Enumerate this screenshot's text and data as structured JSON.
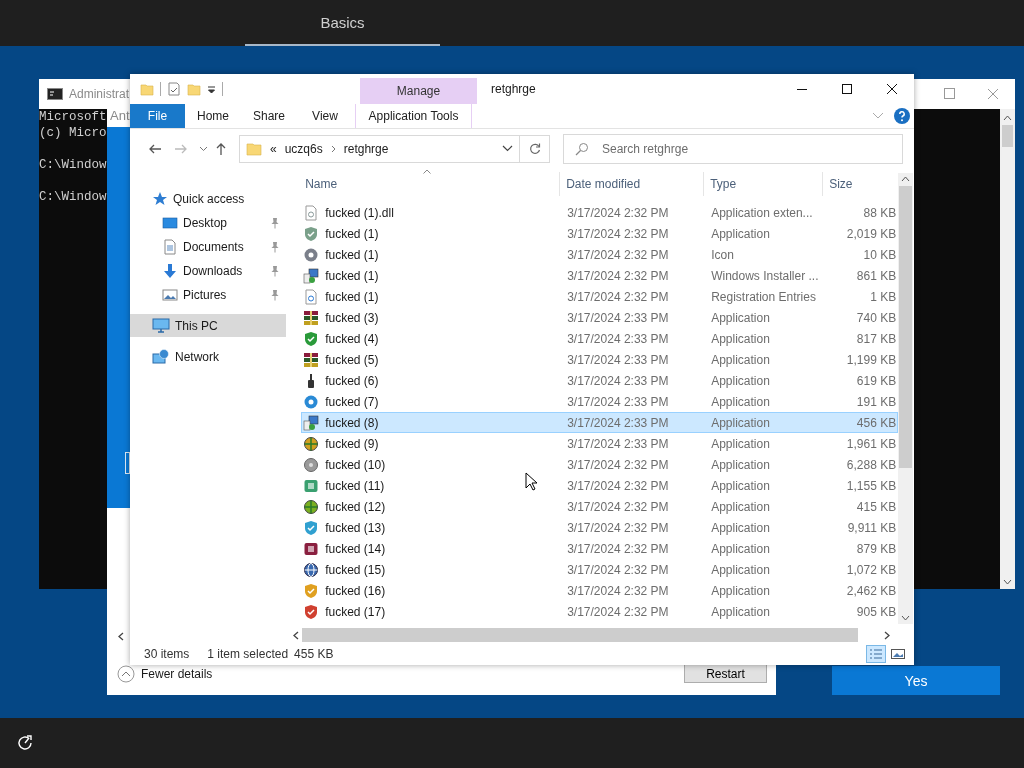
{
  "setup_header": {
    "tabs": [
      {
        "label": "Basics",
        "selected": true
      }
    ]
  },
  "console_window": {
    "title": "Administrat",
    "blocks": [
      [
        "Microsoft",
        "(c) Micro"
      ],
      [
        "C:\\Window"
      ],
      [
        "C:\\Window"
      ]
    ]
  },
  "dialog": {
    "title": "Ant",
    "details_toggle": "Fewer details",
    "buttons": [
      "Restart"
    ]
  },
  "yes_button": "Yes",
  "explorer": {
    "title": "retghrge",
    "context_group": "Manage",
    "ribbon_tabs": [
      {
        "label": "File",
        "kind": "file"
      },
      {
        "label": "Home",
        "kind": "normal"
      },
      {
        "label": "Share",
        "kind": "normal"
      },
      {
        "label": "View",
        "kind": "normal"
      },
      {
        "label": "Application Tools",
        "kind": "contextual"
      }
    ],
    "address": {
      "overflow": "«",
      "breadcrumbs": [
        "uczq6s",
        "retghrge"
      ]
    },
    "search": {
      "placeholder": "Search retghrge"
    },
    "nav_pane": [
      {
        "label": "Quick access",
        "kind": "quick",
        "selected": false,
        "children": [
          {
            "label": "Desktop",
            "kind": "desktop",
            "selected": false,
            "pinned": true
          },
          {
            "label": "Documents",
            "kind": "documents",
            "selected": false,
            "pinned": true
          },
          {
            "label": "Downloads",
            "kind": "downloads",
            "selected": false,
            "pinned": true
          },
          {
            "label": "Pictures",
            "kind": "pictures",
            "selected": false,
            "pinned": true
          }
        ]
      },
      {
        "label": "This PC",
        "kind": "pc",
        "selected": true
      },
      {
        "label": "Network",
        "kind": "network",
        "selected": false
      }
    ],
    "columns": [
      {
        "label": "Name",
        "sorted": true
      },
      {
        "label": "Date modified",
        "sorted": false
      },
      {
        "label": "Type",
        "sorted": false
      },
      {
        "label": "Size",
        "sorted": false
      }
    ],
    "rows": [
      {
        "name": "fucked (1).dll",
        "date": "3/17/2024 2:32 PM",
        "type": "Application exten...",
        "size": "88 KB",
        "selected": false
      },
      {
        "name": "fucked (1)",
        "date": "3/17/2024 2:32 PM",
        "type": "Application",
        "size": "2,019 KB",
        "selected": false
      },
      {
        "name": "fucked (1)",
        "date": "3/17/2024 2:32 PM",
        "type": "Icon",
        "size": "10 KB",
        "selected": false
      },
      {
        "name": "fucked (1)",
        "date": "3/17/2024 2:32 PM",
        "type": "Windows Installer ...",
        "size": "861 KB",
        "selected": false
      },
      {
        "name": "fucked (1)",
        "date": "3/17/2024 2:32 PM",
        "type": "Registration Entries",
        "size": "1 KB",
        "selected": false
      },
      {
        "name": "fucked (3)",
        "date": "3/17/2024 2:33 PM",
        "type": "Application",
        "size": "740 KB",
        "selected": false
      },
      {
        "name": "fucked (4)",
        "date": "3/17/2024 2:33 PM",
        "type": "Application",
        "size": "817 KB",
        "selected": false
      },
      {
        "name": "fucked (5)",
        "date": "3/17/2024 2:33 PM",
        "type": "Application",
        "size": "1,199 KB",
        "selected": false
      },
      {
        "name": "fucked (6)",
        "date": "3/17/2024 2:33 PM",
        "type": "Application",
        "size": "619 KB",
        "selected": false
      },
      {
        "name": "fucked (7)",
        "date": "3/17/2024 2:33 PM",
        "type": "Application",
        "size": "191 KB",
        "selected": false
      },
      {
        "name": "fucked (8)",
        "date": "3/17/2024 2:33 PM",
        "type": "Application",
        "size": "456 KB",
        "selected": true
      },
      {
        "name": "fucked (9)",
        "date": "3/17/2024 2:33 PM",
        "type": "Application",
        "size": "1,961 KB",
        "selected": false
      },
      {
        "name": "fucked (10)",
        "date": "3/17/2024 2:32 PM",
        "type": "Application",
        "size": "6,288 KB",
        "selected": false
      },
      {
        "name": "fucked (11)",
        "date": "3/17/2024 2:32 PM",
        "type": "Application",
        "size": "1,155 KB",
        "selected": false
      },
      {
        "name": "fucked (12)",
        "date": "3/17/2024 2:32 PM",
        "type": "Application",
        "size": "415 KB",
        "selected": false
      },
      {
        "name": "fucked (13)",
        "date": "3/17/2024 2:32 PM",
        "type": "Application",
        "size": "9,911 KB",
        "selected": false
      },
      {
        "name": "fucked (14)",
        "date": "3/17/2024 2:32 PM",
        "type": "Application",
        "size": "879 KB",
        "selected": false
      },
      {
        "name": "fucked (15)",
        "date": "3/17/2024 2:32 PM",
        "type": "Application",
        "size": "1,072 KB",
        "selected": false
      },
      {
        "name": "fucked (16)",
        "date": "3/17/2024 2:32 PM",
        "type": "Application",
        "size": "2,462 KB",
        "selected": false
      },
      {
        "name": "fucked (17)",
        "date": "3/17/2024 2:32 PM",
        "type": "Application",
        "size": "905 KB",
        "selected": false
      }
    ],
    "status_bar": {
      "item_count": "30 items",
      "selection": "1 item selected",
      "selection_size": "455 KB"
    },
    "views": [
      {
        "kind": "details",
        "selected": true
      },
      {
        "kind": "large_icons",
        "selected": false
      }
    ]
  }
}
